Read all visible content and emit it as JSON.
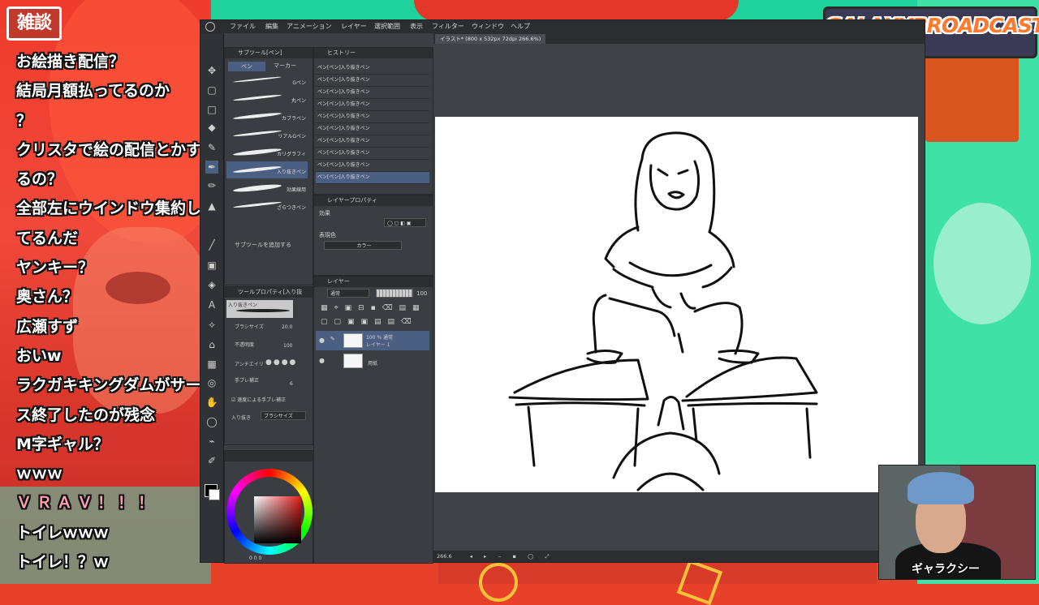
{
  "overlay": {
    "category_tag": "雑談",
    "logo": "GALAXYBROADCAST",
    "streamer_name": "ギャラクシー",
    "chat_messages": [
      "お絵描き配信？",
      "結局月額払ってるのか",
      "？",
      "クリスタで絵の配信とかす",
      "るの？",
      "全部左にウインドウ集約し",
      "てるんだ",
      "ヤンキー？",
      "奥さん？",
      "広瀬すず",
      "おいw",
      "ラクガキキングダムがサービ",
      "ス終了したのが残念",
      "M字ギャル？",
      "ｗｗｗ",
      "ＶＲＡＶ！！！",
      "トイレｗｗｗ",
      "トイレ！？ｗ"
    ]
  },
  "app": {
    "menu": [
      "ファイル",
      "編集",
      "アニメーション",
      "レイヤー",
      "選択範囲",
      "表示",
      "フィルター",
      "ウィンドウ",
      "ヘルプ"
    ],
    "canvas_tab": "イラスト* (800 x 532px 72dpi 266.6%)",
    "subtool_panel": {
      "title": "サブツール[ペン]",
      "tab_pen": "ペン",
      "tab_marker": "マーカー",
      "brushes": [
        "Gペン",
        "丸ペン",
        "カブラペン",
        "リアルGペン",
        "カリグラフィ",
        "入り抜きペン",
        "効果線用",
        "ざらつきペン"
      ],
      "add_subtool": "サブツールを追加する"
    },
    "history_panel": {
      "title": "ヒストリー",
      "items": [
        "ペン[ペン]入り抜きペン",
        "ペン[ペン]入り抜きペン",
        "ペン[ペン]入り抜きペン",
        "ペン[ペン]入り抜きペン",
        "ペン[ペン]入り抜きペン",
        "ペン[ペン]入り抜きペン",
        "ペン[ペン]入り抜きペン",
        "ペン[ペン]入り抜きペン",
        "ペン[ペン]入り抜きペン",
        "ペン[ペン]入り抜きペン"
      ]
    },
    "layer_property_panel": {
      "title": "レイヤープロパティ",
      "effect_label": "効果",
      "color_label": "表現色",
      "color_value": "カラー"
    },
    "layer_panel": {
      "title": "レイヤー",
      "blend_mode": "通常",
      "opacity": "100",
      "layer1_percent": "100 % 通常",
      "layer1_name": "レイヤー 1",
      "layer2_name": "用紙"
    },
    "tool_property_panel": {
      "title": "ツールプロパティ[入り抜",
      "brush_preview": "入り抜きペン",
      "brush_size_label": "ブラシサイズ",
      "brush_size": "20.0",
      "opacity_label": "不透明度",
      "opacity": "100",
      "antialias_label": "アンチエイリ",
      "stabilization_label": "手ブレ補正",
      "stabilization": "6",
      "speed_stabilization": "速度による手ブレ補正",
      "taper_label": "入り抜き",
      "taper_value": "ブラシサイズ"
    },
    "color_panel_values": "0 0 0",
    "status_zoom": "266.6"
  }
}
